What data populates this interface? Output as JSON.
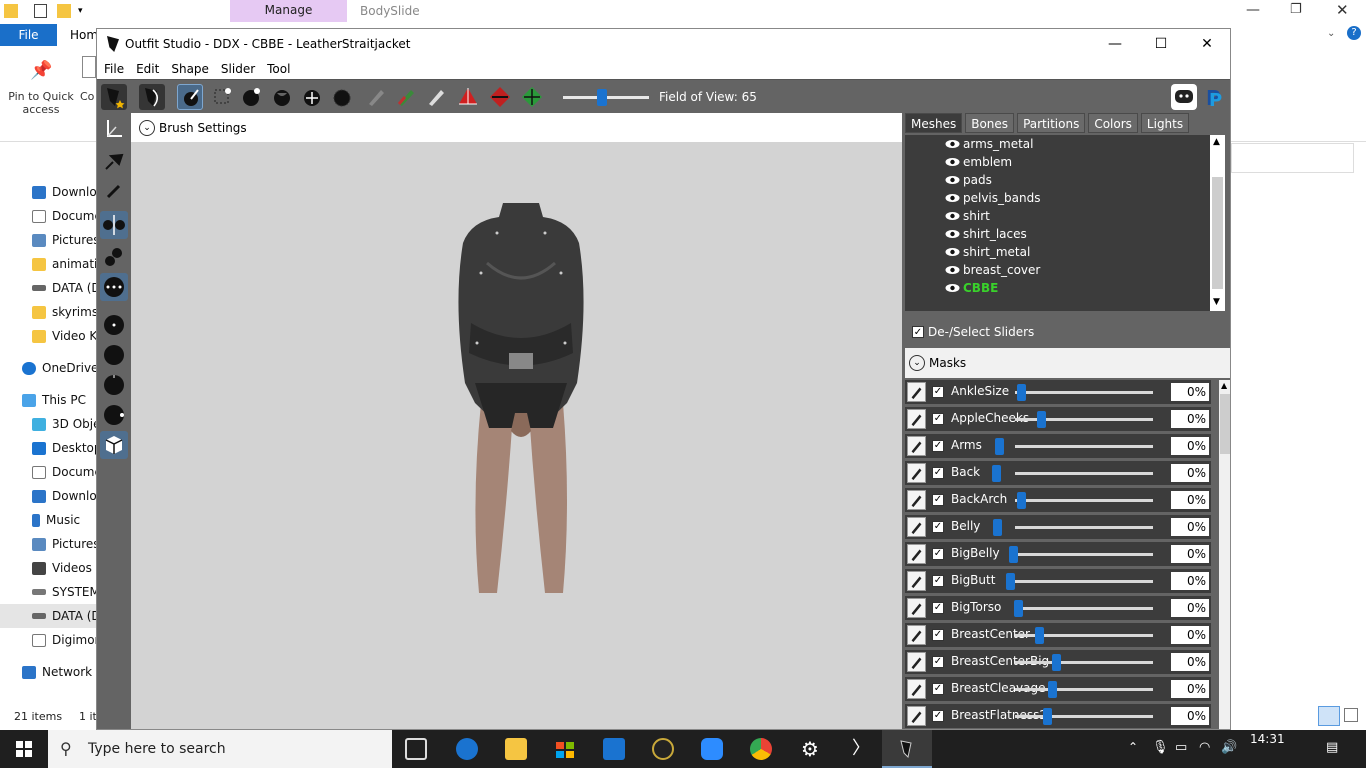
{
  "explorer": {
    "ribbon_tab_manage": "Manage",
    "ribbon_tab_bodyslide": "BodySlide",
    "file_label": "File",
    "home_label": "Hom",
    "pin_label": "Pin to Quick access",
    "co_label": "Co",
    "nav_items": [
      "Downlo",
      "Docume",
      "Pictures",
      "animatio",
      "DATA (D",
      "skyrims",
      "Video Kr",
      "OneDrive",
      "This PC",
      "3D Obje",
      "Desktop",
      "Docume",
      "Downlo",
      "Music",
      "Pictures",
      "Videos",
      "SYSTEM",
      "DATA (D",
      "Digimon",
      "Network"
    ],
    "status_items": "21 items",
    "status_selected": "1 it"
  },
  "window": {
    "title": "Outfit Studio - DDX - CBBE - LeatherStraitjacket",
    "menu": [
      "File",
      "Edit",
      "Shape",
      "Slider",
      "Tool"
    ],
    "fov_label": "Field of View: 65",
    "fov_value": 65
  },
  "viewport": {
    "brush_settings": "Brush Settings"
  },
  "meshes_panel": {
    "tabs": [
      "Meshes",
      "Bones",
      "Partitions",
      "Colors",
      "Lights"
    ],
    "meshes": [
      "arms_metal",
      "emblem",
      "pads",
      "pelvis_bands",
      "shirt",
      "shirt_laces",
      "shirt_metal",
      "breast_cover",
      "CBBE"
    ],
    "active_mesh_color": "#39d12b"
  },
  "sliders_panel": {
    "deselect_label": "De-/Select Sliders",
    "masks_label": "Masks",
    "sliders": [
      {
        "name": "AnkleSize",
        "value": "0%"
      },
      {
        "name": "AppleCheeks",
        "value": "0%"
      },
      {
        "name": "Arms",
        "value": "0%"
      },
      {
        "name": "Back",
        "value": "0%"
      },
      {
        "name": "BackArch",
        "value": "0%"
      },
      {
        "name": "Belly",
        "value": "0%"
      },
      {
        "name": "BigBelly",
        "value": "0%"
      },
      {
        "name": "BigButt",
        "value": "0%"
      },
      {
        "name": "BigTorso",
        "value": "0%"
      },
      {
        "name": "BreastCenter",
        "value": "0%"
      },
      {
        "name": "BreastCenterBig",
        "value": "0%"
      },
      {
        "name": "BreastCleavage",
        "value": "0%"
      },
      {
        "name": "BreastFlatness2",
        "value": "0%"
      }
    ]
  },
  "taskbar": {
    "search_placeholder": "Type here to search",
    "time": "14:31"
  }
}
